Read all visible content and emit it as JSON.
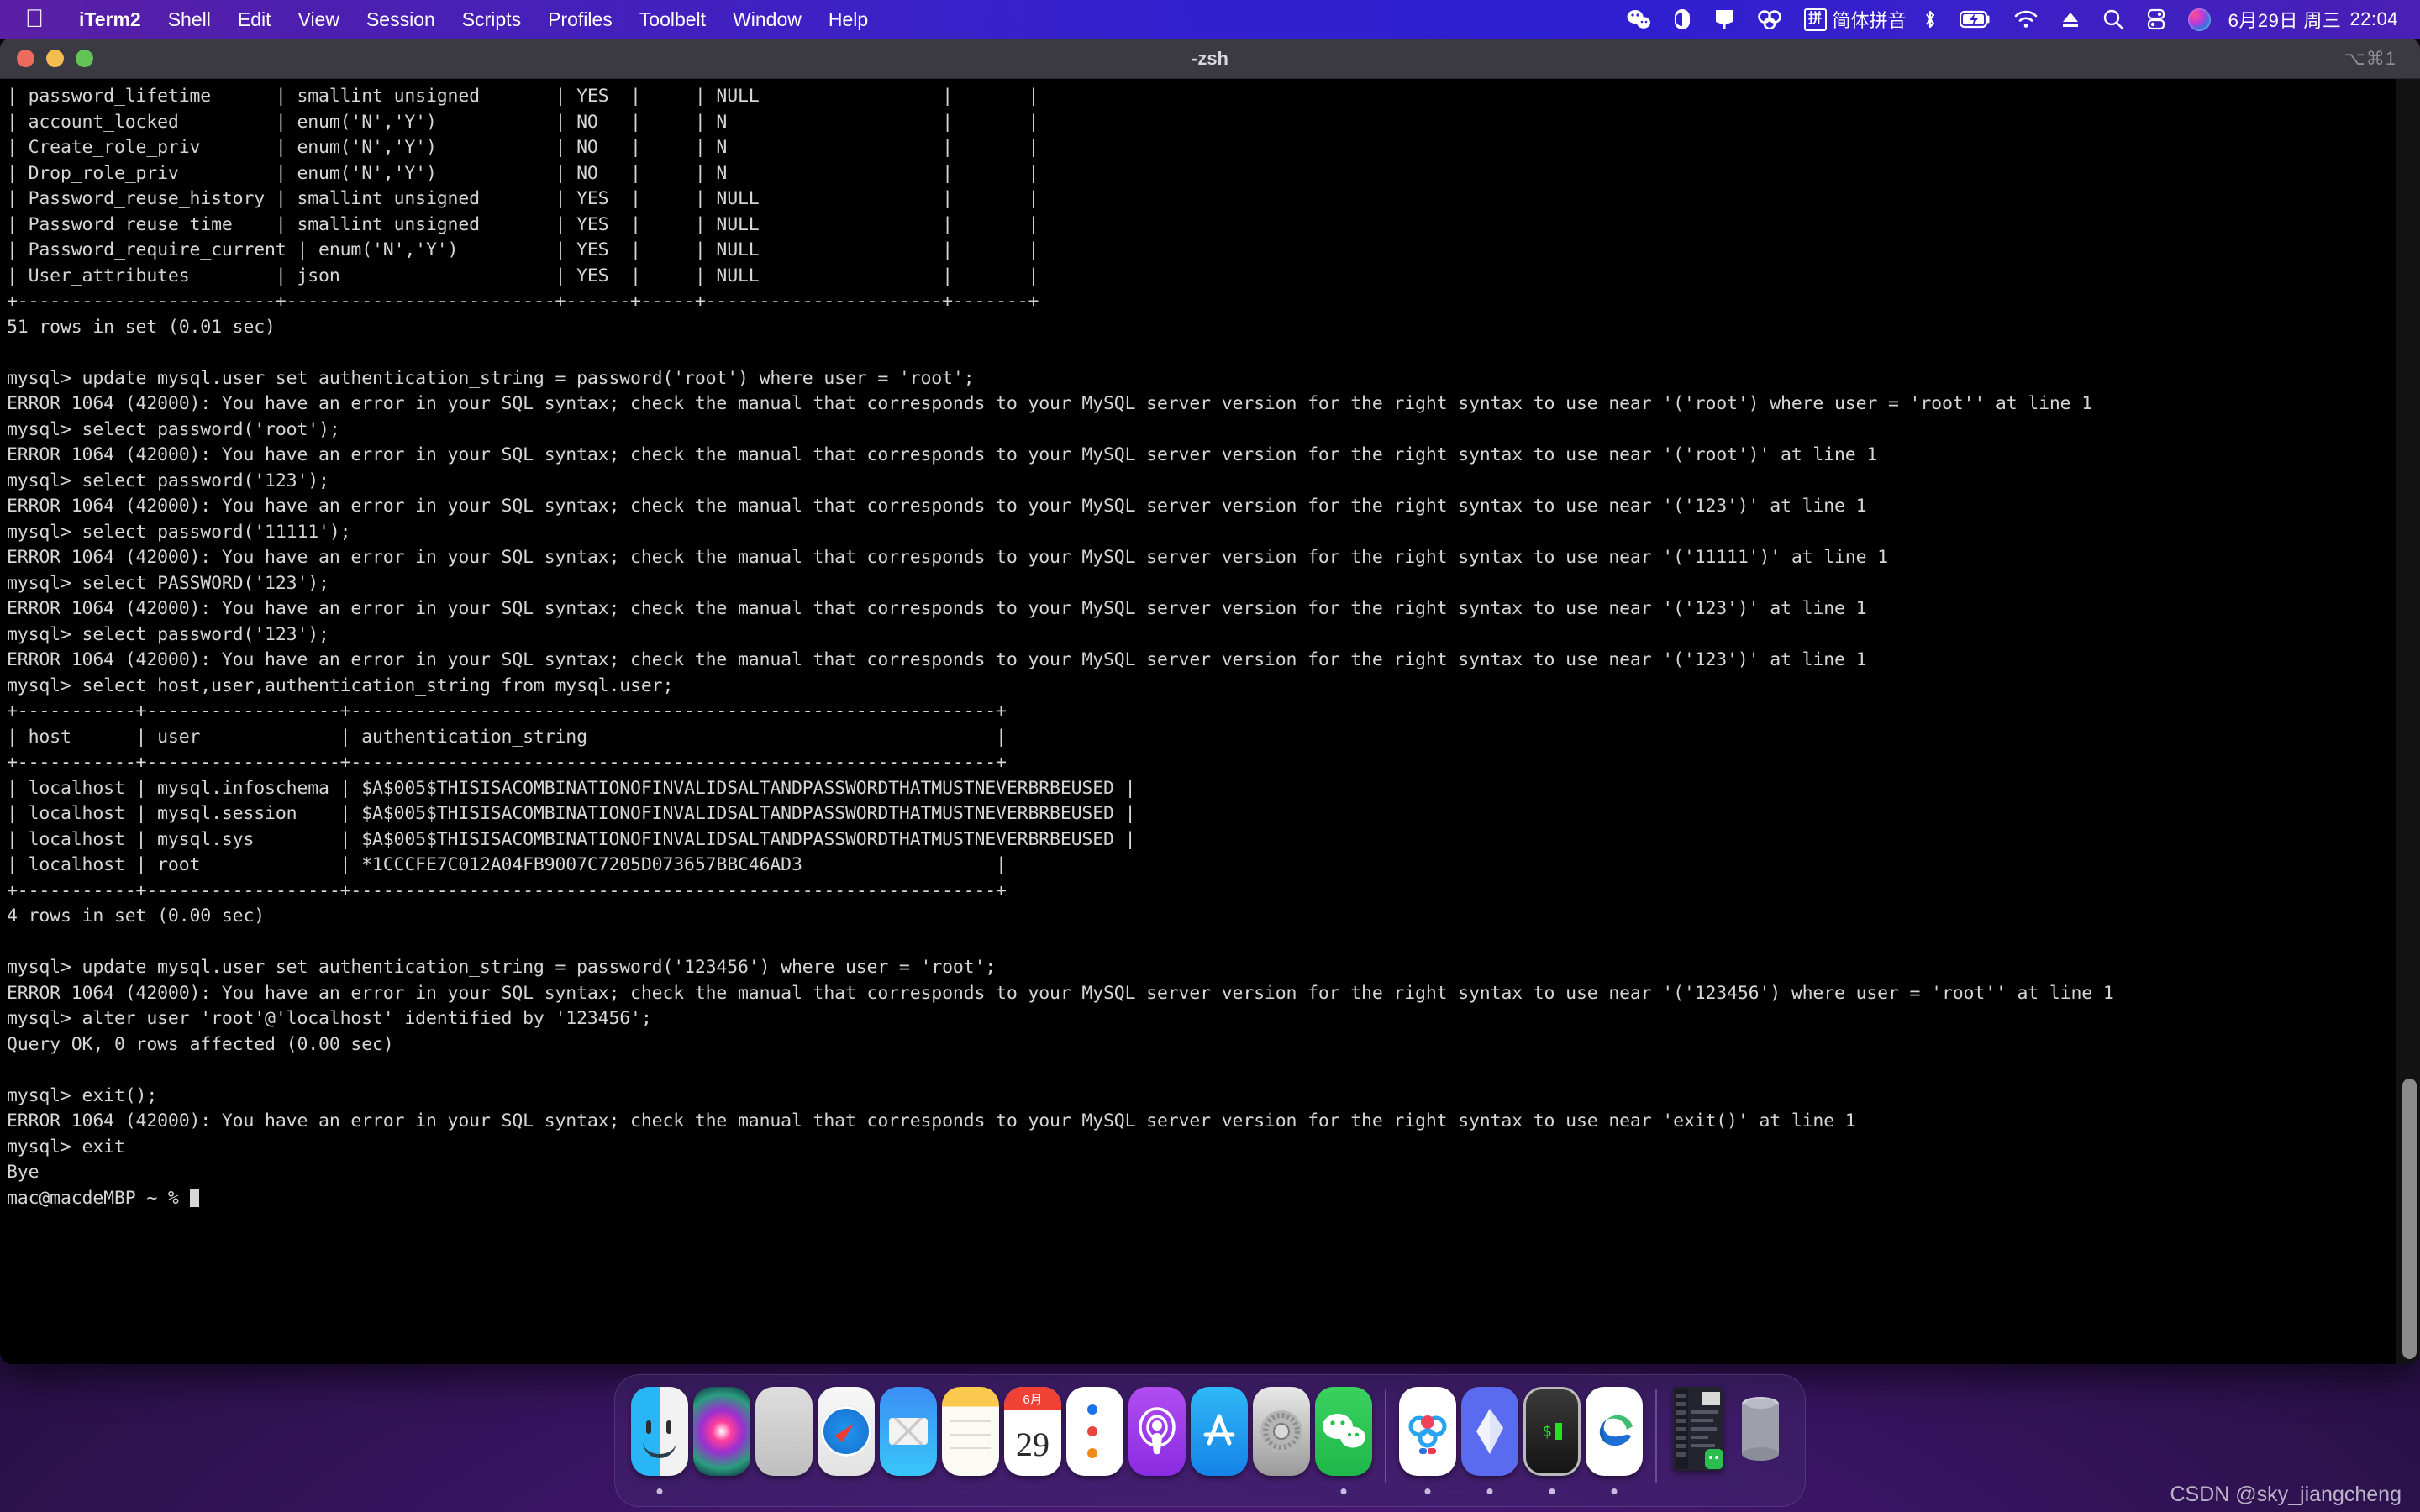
{
  "menubar": {
    "apple_icon": "apple-logo-icon",
    "items": [
      {
        "label": "iTerm2",
        "name": "menu-iterm2",
        "bold": true
      },
      {
        "label": "Shell",
        "name": "menu-shell"
      },
      {
        "label": "Edit",
        "name": "menu-edit"
      },
      {
        "label": "View",
        "name": "menu-view"
      },
      {
        "label": "Session",
        "name": "menu-session"
      },
      {
        "label": "Scripts",
        "name": "menu-scripts"
      },
      {
        "label": "Profiles",
        "name": "menu-profiles"
      },
      {
        "label": "Toolbelt",
        "name": "menu-toolbelt"
      },
      {
        "label": "Window",
        "name": "menu-window"
      },
      {
        "label": "Help",
        "name": "menu-help"
      }
    ],
    "status": {
      "ime_badge": "拼",
      "ime_label": "简体拼音",
      "date": "6月29日 周三",
      "time": "22:04",
      "icons": [
        "wechat-status-icon",
        "moon-status-icon",
        "screen-status-icon",
        "baidu-netdisk-status-icon",
        "bluetooth-icon",
        "battery-charging-icon",
        "wifi-icon",
        "eject-icon",
        "spotlight-search-icon",
        "control-center-icon",
        "siri-icon"
      ]
    },
    "accent_color": "#3220cf"
  },
  "window": {
    "title": "-zsh",
    "shortcut": "⌥⌘1",
    "traffic_lights": [
      "close-button",
      "minimize-button",
      "zoom-button"
    ],
    "titlebar_color": "#3b3a42",
    "background_color": "#000000",
    "text_color": "#d6d6d6"
  },
  "terminal": {
    "lines": [
      "| password_lifetime      | smallint unsigned       | YES  |     | NULL                 |       |",
      "| account_locked         | enum('N','Y')           | NO   |     | N                    |       |",
      "| Create_role_priv       | enum('N','Y')           | NO   |     | N                    |       |",
      "| Drop_role_priv         | enum('N','Y')           | NO   |     | N                    |       |",
      "| Password_reuse_history | smallint unsigned       | YES  |     | NULL                 |       |",
      "| Password_reuse_time    | smallint unsigned       | YES  |     | NULL                 |       |",
      "| Password_require_current | enum('N','Y')         | YES  |     | NULL                 |       |",
      "| User_attributes        | json                    | YES  |     | NULL                 |       |",
      "+------------------------+-------------------------+------+-----+----------------------+-------+",
      "51 rows in set (0.01 sec)",
      "",
      "mysql> update mysql.user set authentication_string = password('root') where user = 'root';",
      "ERROR 1064 (42000): You have an error in your SQL syntax; check the manual that corresponds to your MySQL server version for the right syntax to use near '('root') where user = 'root'' at line 1",
      "mysql> select password('root');",
      "ERROR 1064 (42000): You have an error in your SQL syntax; check the manual that corresponds to your MySQL server version for the right syntax to use near '('root')' at line 1",
      "mysql> select password('123');",
      "ERROR 1064 (42000): You have an error in your SQL syntax; check the manual that corresponds to your MySQL server version for the right syntax to use near '('123')' at line 1",
      "mysql> select password('11111');",
      "ERROR 1064 (42000): You have an error in your SQL syntax; check the manual that corresponds to your MySQL server version for the right syntax to use near '('11111')' at line 1",
      "mysql> select PASSWORD('123');",
      "ERROR 1064 (42000): You have an error in your SQL syntax; check the manual that corresponds to your MySQL server version for the right syntax to use near '('123')' at line 1",
      "mysql> select password('123');",
      "ERROR 1064 (42000): You have an error in your SQL syntax; check the manual that corresponds to your MySQL server version for the right syntax to use near '('123')' at line 1",
      "mysql> select host,user,authentication_string from mysql.user;",
      "+-----------+------------------+------------------------------------------------------------+",
      "| host      | user             | authentication_string                                      |",
      "+-----------+------------------+------------------------------------------------------------+",
      "| localhost | mysql.infoschema | $A$005$THISISACOMBINATIONOFINVALIDSALTANDPASSWORDTHATMUSTNEVERBRBEUSED |",
      "| localhost | mysql.session    | $A$005$THISISACOMBINATIONOFINVALIDSALTANDPASSWORDTHATMUSTNEVERBRBEUSED |",
      "| localhost | mysql.sys        | $A$005$THISISACOMBINATIONOFINVALIDSALTANDPASSWORDTHATMUSTNEVERBRBEUSED |",
      "| localhost | root             | *1CCCFE7C012A04FB9007C7205D073657BBC46AD3                  |",
      "+-----------+------------------+------------------------------------------------------------+",
      "4 rows in set (0.00 sec)",
      "",
      "mysql> update mysql.user set authentication_string = password('123456') where user = 'root';",
      "ERROR 1064 (42000): You have an error in your SQL syntax; check the manual that corresponds to your MySQL server version for the right syntax to use near '('123456') where user = 'root'' at line 1",
      "mysql> alter user 'root'@'localhost' identified by '123456';",
      "Query OK, 0 rows affected (0.00 sec)",
      "",
      "mysql> exit();",
      "ERROR 1064 (42000): You have an error in your SQL syntax; check the manual that corresponds to your MySQL server version for the right syntax to use near 'exit()' at line 1",
      "mysql> exit",
      "Bye"
    ],
    "prompt": "mac@macdeMBP ~ % "
  },
  "dock": {
    "items": [
      {
        "label": "Finder",
        "name": "dock-item-finder",
        "running": true
      },
      {
        "label": "Siri",
        "name": "dock-item-siri",
        "running": false
      },
      {
        "label": "Launchpad",
        "name": "dock-item-launchpad",
        "running": false
      },
      {
        "label": "Safari",
        "name": "dock-item-safari",
        "running": false
      },
      {
        "label": "Mail",
        "name": "dock-item-mail",
        "running": false
      },
      {
        "label": "Notes",
        "name": "dock-item-notes",
        "running": false
      },
      {
        "label": "Calendar",
        "name": "dock-item-calendar",
        "running": false,
        "month": "6月",
        "day": "29"
      },
      {
        "label": "Reminders",
        "name": "dock-item-reminders",
        "running": false
      },
      {
        "label": "Podcasts",
        "name": "dock-item-podcasts",
        "running": false
      },
      {
        "label": "App Store",
        "name": "dock-item-app-store",
        "running": false
      },
      {
        "label": "System Preferences",
        "name": "dock-item-system-preferences",
        "running": false
      },
      {
        "label": "WeChat",
        "name": "dock-item-wechat",
        "running": true
      },
      {
        "separator": true,
        "name": "dock-separator-1"
      },
      {
        "label": "Baidu Netdisk",
        "name": "dock-item-baidu-netdisk",
        "running": true
      },
      {
        "label": "Sketch",
        "name": "dock-item-sketch",
        "running": true
      },
      {
        "label": "iTerm2",
        "name": "dock-item-iterm2",
        "running": true,
        "prompt": "$"
      },
      {
        "label": "Microsoft Edge",
        "name": "dock-item-edge",
        "running": true
      },
      {
        "separator": true,
        "name": "dock-separator-2"
      },
      {
        "label": "Window Preview",
        "name": "dock-item-window-preview",
        "running": false
      },
      {
        "label": "Trash",
        "name": "dock-item-trash",
        "running": false
      }
    ]
  },
  "watermark": "CSDN @sky_jiangcheng"
}
